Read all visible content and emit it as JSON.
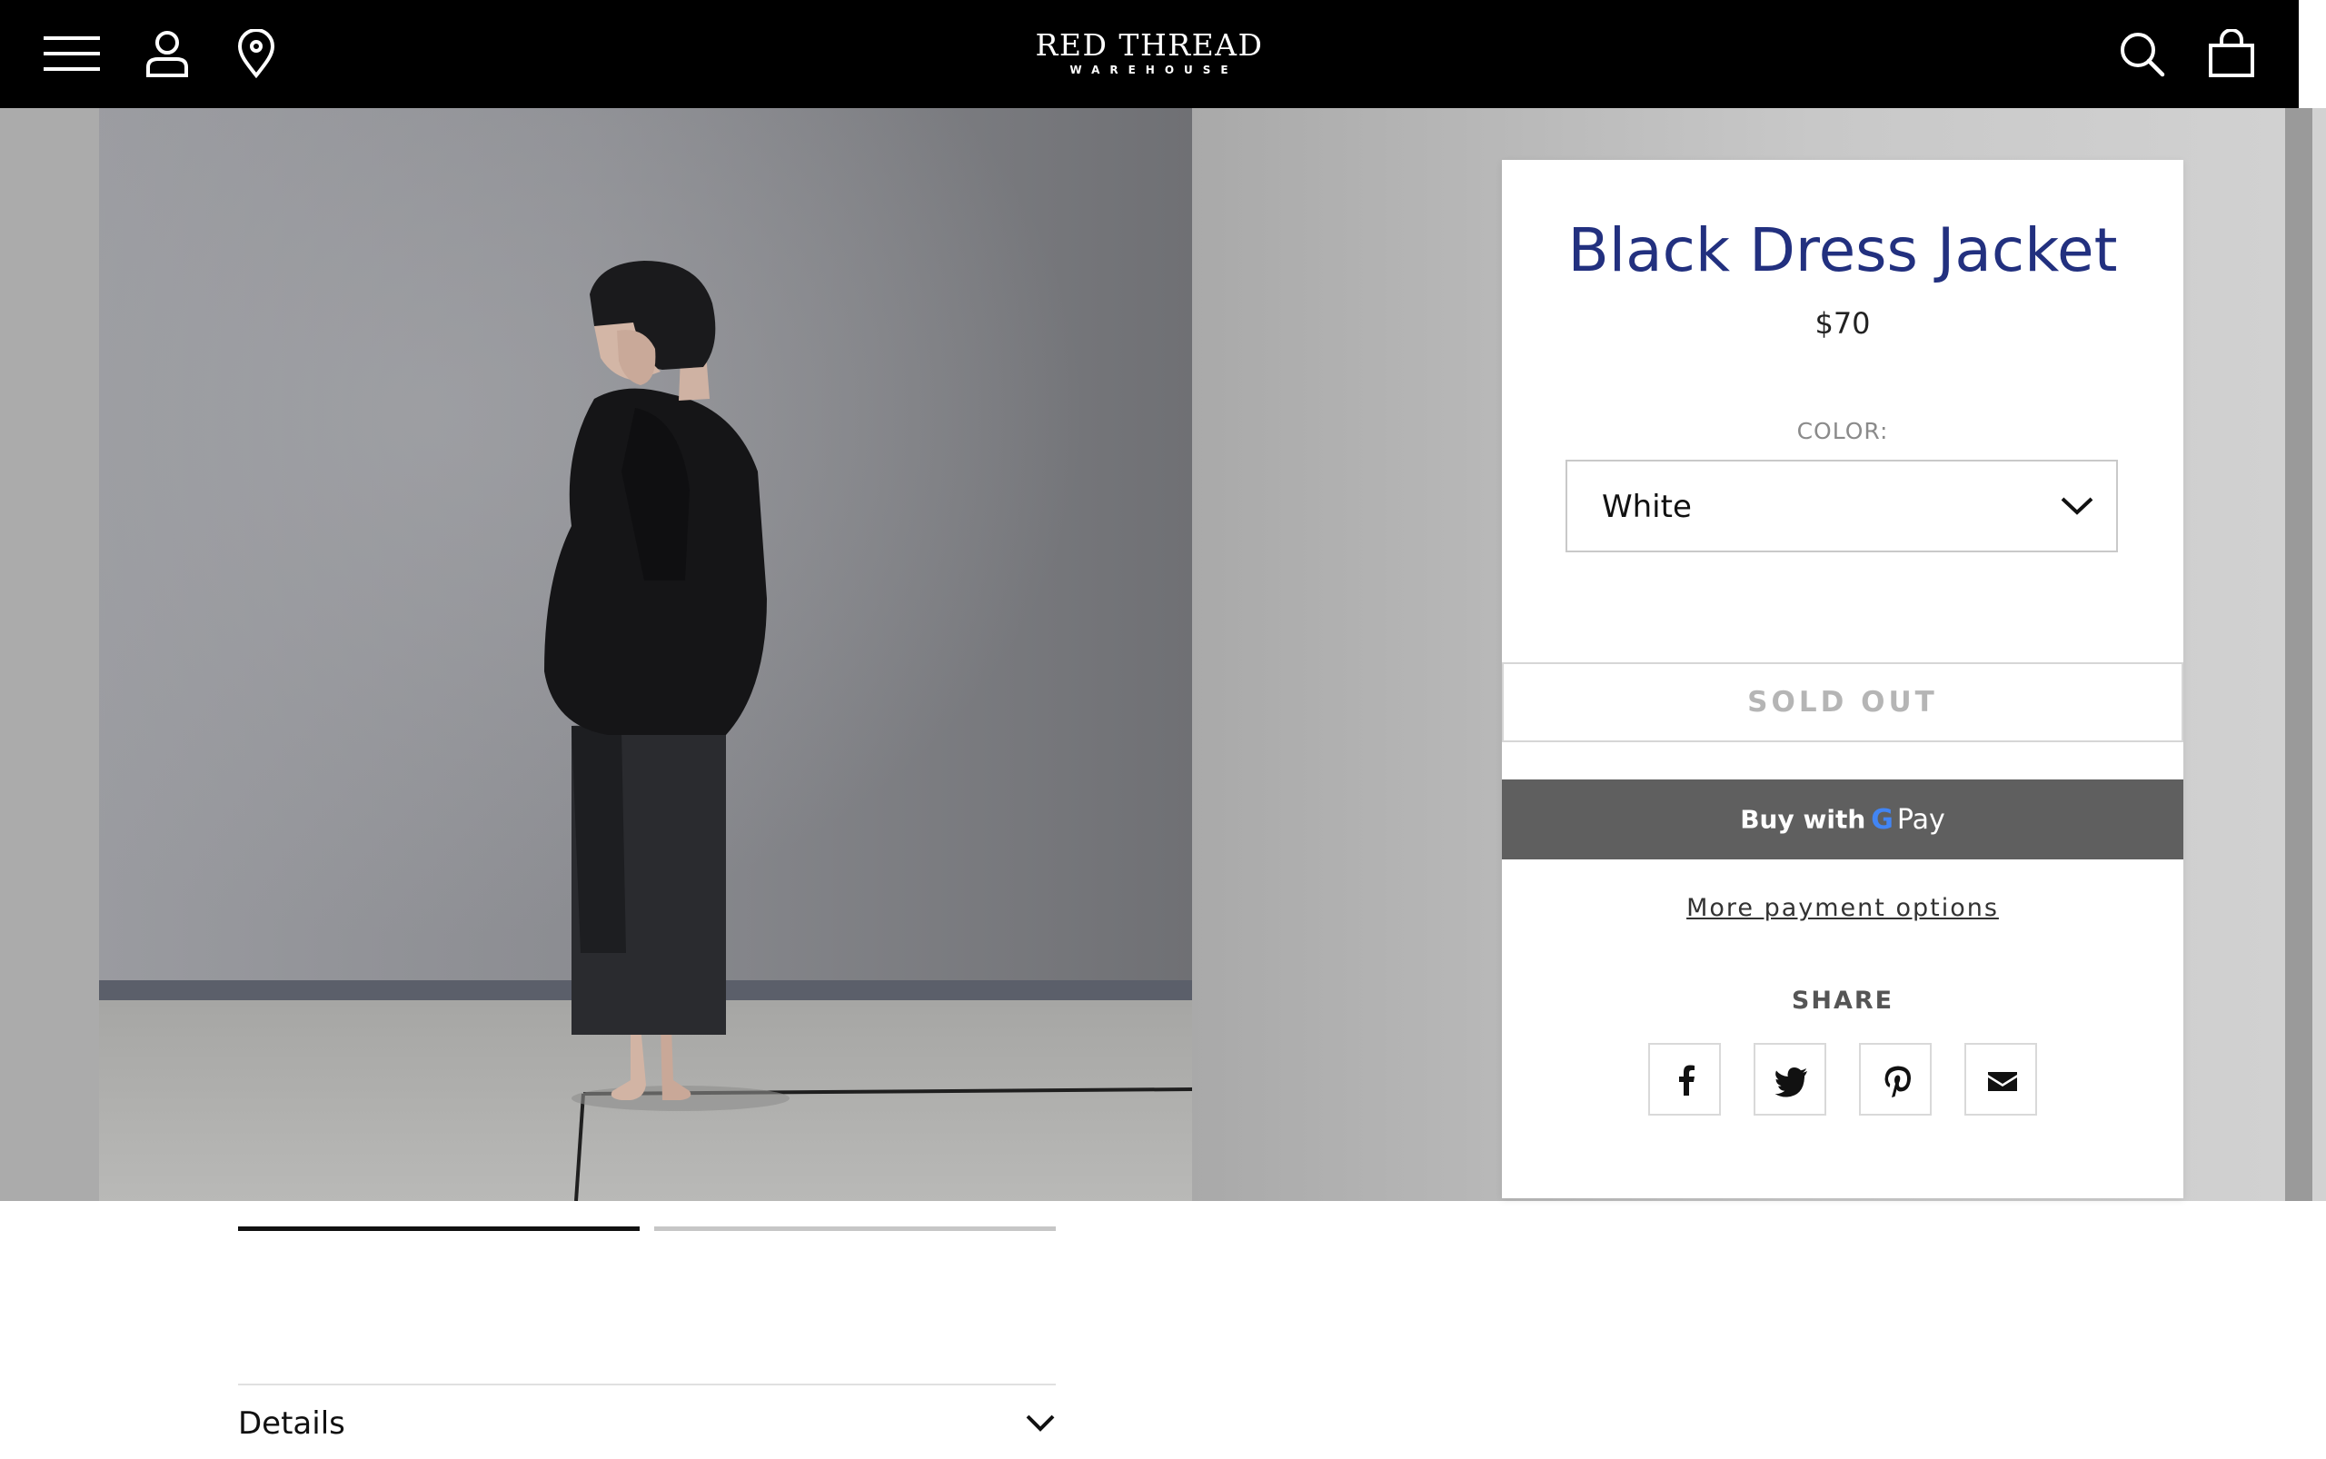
{
  "header": {
    "brand_main": "RED THREAD",
    "brand_sub": "WAREHOUSE",
    "icons": [
      "menu-icon",
      "account-icon",
      "location-pin-icon",
      "search-icon",
      "shopping-bag-icon"
    ]
  },
  "product": {
    "title": "Black Dress Jacket",
    "price": "$70",
    "color_label": "COLOR:",
    "color_value": "White",
    "sold_out_label": "SOLD OUT",
    "buy_with_label": "Buy with",
    "gpay_g": "G",
    "gpay_pay": "Pay",
    "more_payment_label": "More payment options",
    "share_label": "SHARE",
    "share_icons": [
      "facebook-icon",
      "twitter-icon",
      "pinterest-icon",
      "email-icon"
    ]
  },
  "gallery": {
    "slides": 2,
    "active_slide": 1
  },
  "details": {
    "label": "Details"
  },
  "colors": {
    "header_bg": "#000000",
    "title": "#22307f",
    "gpay_bg": "#5f5f5f",
    "sold_out_text": "#b5b5b5"
  }
}
